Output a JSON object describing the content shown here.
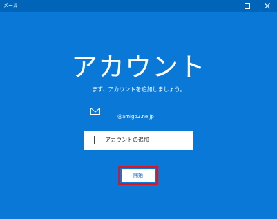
{
  "window": {
    "title": "メール",
    "controls": [
      "minimize-icon",
      "maximize-icon",
      "close-icon"
    ]
  },
  "main": {
    "heading": "アカウント",
    "subtitle": "まず、アカウントを追加しましょう。",
    "account": {
      "icon": "mail-icon",
      "email": "@amigo2.ne.jp"
    },
    "add_account": {
      "icon": "plus-icon",
      "label": "アカウントの追加"
    },
    "start_button": {
      "label": "開始"
    }
  },
  "colors": {
    "background": "#0a78d7",
    "titlebar": "#0064b8",
    "highlight": "#e0141e",
    "button_text": "#0a64c8"
  }
}
